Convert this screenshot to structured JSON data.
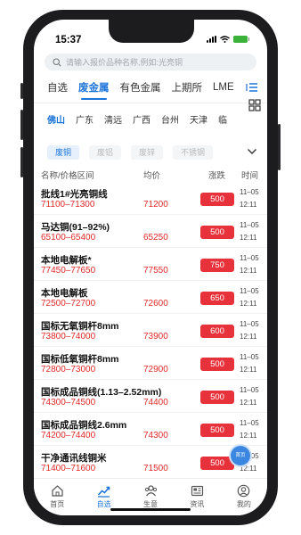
{
  "status_bar": {
    "time": "15:37"
  },
  "search": {
    "placeholder": "请输入报价品种名称,例如:光亮铜"
  },
  "tabs": [
    {
      "label": "自选"
    },
    {
      "label": "废金属"
    },
    {
      "label": "有色金属"
    },
    {
      "label": "上期所"
    },
    {
      "label": "LME"
    }
  ],
  "cities": [
    "佛山",
    "广东",
    "清远",
    "广西",
    "台州",
    "天津",
    "临"
  ],
  "chips": [
    "废铜",
    "废铝",
    "废锌",
    "不锈钢"
  ],
  "columns": {
    "name": "名称/价格区间",
    "avg": "均价",
    "change": "涨跌",
    "time": "时间"
  },
  "rows": [
    {
      "name": "批线1#光亮铜线",
      "range": "71100–71300",
      "avg": "71200",
      "change": "500",
      "date": "11–05",
      "time": "12:11"
    },
    {
      "name": "马达铜(91–92%)",
      "range": "65100–65400",
      "avg": "65250",
      "change": "500",
      "date": "11–05",
      "time": "12:11"
    },
    {
      "name": "本地电解板*",
      "range": "77450–77650",
      "avg": "77550",
      "change": "750",
      "date": "11–05",
      "time": "12:11"
    },
    {
      "name": "本地电解板",
      "range": "72500–72700",
      "avg": "72600",
      "change": "650",
      "date": "11–05",
      "time": "12:11"
    },
    {
      "name": "国标无氧铜杆8mm",
      "range": "73800–74000",
      "avg": "73900",
      "change": "600",
      "date": "11–05",
      "time": "12:11"
    },
    {
      "name": "国标低氧铜杆8mm",
      "range": "72800–73000",
      "avg": "72900",
      "change": "500",
      "date": "11–05",
      "time": "12:11"
    },
    {
      "name": "国标成品铜线(1.13–2.52mm)",
      "range": "74300–74500",
      "avg": "74400",
      "change": "500",
      "date": "11–05",
      "time": "12:11"
    },
    {
      "name": "国标成品铜线2.6mm",
      "range": "74200–74400",
      "avg": "74300",
      "change": "500",
      "date": "11–05",
      "time": "12:11"
    },
    {
      "name": "干净通讯线铜米",
      "range": "71400–71600",
      "avg": "71500",
      "change": "500",
      "date": "11–05",
      "time": "12:11"
    }
  ],
  "float_button": {
    "label": "首页"
  },
  "bottom_nav": [
    {
      "label": "首页",
      "icon": "home-icon"
    },
    {
      "label": "自选",
      "icon": "chart-icon"
    },
    {
      "label": "生意",
      "icon": "people-icon"
    },
    {
      "label": "资讯",
      "icon": "news-icon"
    },
    {
      "label": "我的",
      "icon": "profile-icon"
    }
  ],
  "colors": {
    "accent": "#1a73d8",
    "price_red": "#e02a2a",
    "change_badge": "#e8323b"
  }
}
